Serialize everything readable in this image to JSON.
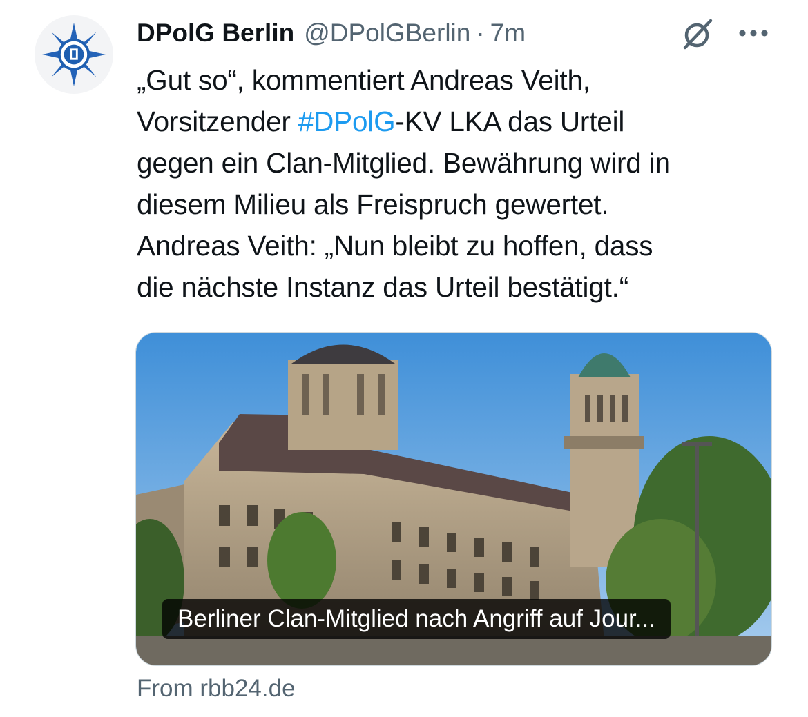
{
  "tweet": {
    "author_name": "DPolG Berlin",
    "author_handle": "@DPolGBerlin",
    "separator": "·",
    "time": "7m",
    "avatar_icon": "police-star-logo",
    "grok_icon": "grok-icon",
    "more_icon": "more-icon",
    "text_lines": {
      "l1": "„Gut so“, kommentiert Andreas Veith,",
      "l2_before": "Vorsitzender ",
      "l2_hashtag": "#DPolG",
      "l2_after": "-KV LKA das Urteil",
      "l3": "gegen ein Clan-Mitglied. Bewährung wird in",
      "l4": "diesem Milieu als Freispruch gewertet.",
      "l5": "Andreas Veith: „Nun bleibt zu hoffen, dass",
      "l6": "die nächste Instanz das Urteil bestätigt.“"
    }
  },
  "link_card": {
    "title": "Berliner Clan-Mitglied nach Angriff auf Jour...",
    "source": "From rbb24.de"
  },
  "colors": {
    "text": "#0f1419",
    "secondary": "#536471",
    "link": "#1d9bf0",
    "logo_blue": "#1f5fb0"
  }
}
